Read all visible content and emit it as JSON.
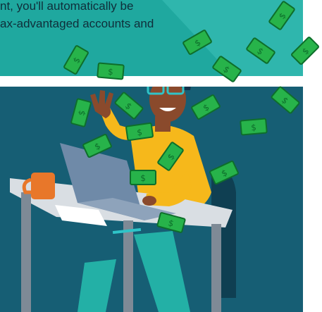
{
  "banner": {
    "line1": "nt, you'll automatically be",
    "line2": "ax-advantaged accounts and"
  },
  "illustration": {
    "bill_symbol": "$",
    "colors": {
      "banner": "#1fa89f",
      "scene": "#165e74",
      "bill": "#27b34a",
      "shirt": "#f6b81b",
      "skin": "#8a4a2c",
      "hair": "#12324a",
      "glasses": "#2fc4c8",
      "laptop": "#6f8aa8",
      "desk": "#d9dee3",
      "pants": "#23b0a6",
      "mug": "#e8772a"
    }
  }
}
